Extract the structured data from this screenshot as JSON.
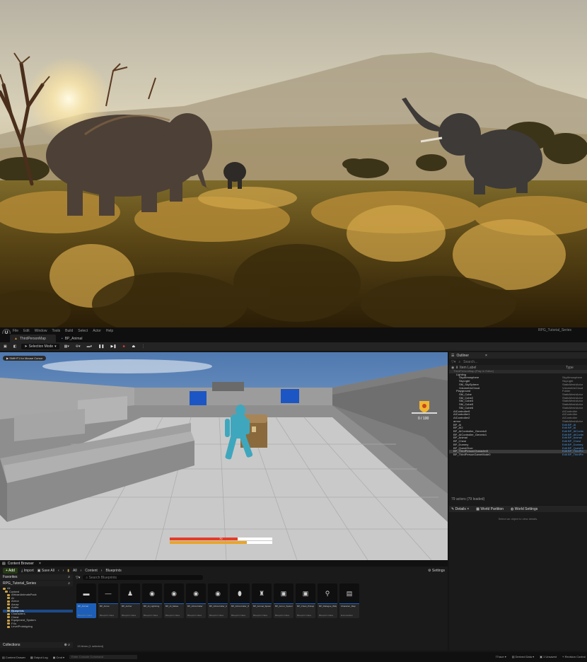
{
  "menu": {
    "items": [
      "File",
      "Edit",
      "Window",
      "Tools",
      "Build",
      "Select",
      "Actor",
      "Help"
    ],
    "project_name": "RPG_Tutorial_Series"
  },
  "tabs": [
    {
      "label": "ThirdPersonMap"
    },
    {
      "label": "BP_Animal"
    }
  ],
  "toolbar": {
    "selection_mode": "Selection Mode"
  },
  "viewport": {
    "hint": "Shift+F1 for Mouse Cursor",
    "hp_value": "70",
    "hp_fraction": 0.66,
    "stamina_fraction": 0.75,
    "gold_value": "0 / 100"
  },
  "outliner": {
    "title": "Outliner",
    "search_placeholder": "Search...",
    "col_label": "Item Label",
    "col_type": "Type",
    "rows": [
      {
        "label": "ThirdPersonMap (Play In Editor)",
        "type": ""
      },
      {
        "label": "Lighting",
        "type": ""
      },
      {
        "label": "SkyAtmosphere",
        "type": "SkyAtmosphere"
      },
      {
        "label": "SkyLight",
        "type": "SkyLight"
      },
      {
        "label": "SM_SkySphere",
        "type": "StaticMeshActor"
      },
      {
        "label": "VolumetricCloud",
        "type": "VolumetricCloud"
      },
      {
        "label": "Playground",
        "type": "Folder"
      },
      {
        "label": "SM_Cube",
        "type": "StaticMeshActor"
      },
      {
        "label": "SM_Cube2",
        "type": "StaticMeshActor"
      },
      {
        "label": "SM_Cube3",
        "type": "StaticMeshActor"
      },
      {
        "label": "SM_Cube5",
        "type": "StaticMeshActor"
      },
      {
        "label": "SM_Cube6",
        "type": "StaticMeshActor"
      },
      {
        "label": "AIController9",
        "type": "AIController"
      },
      {
        "label": "AIController1",
        "type": "AIController"
      },
      {
        "label": "AIController2",
        "type": "AIController"
      },
      {
        "label": "armor",
        "type": "StaticMeshActor"
      },
      {
        "label": "BP_AI",
        "type": "Edit BP_AI"
      },
      {
        "label": "BP_AI2",
        "type": "Edit BP_AI"
      },
      {
        "label": "BP_AIController_Generic0",
        "type": "Edit BP_AIController"
      },
      {
        "label": "BP_AIController_Generic1",
        "type": "Edit BP_AIController"
      },
      {
        "label": "BP_Animal",
        "type": "Edit BP_Animal"
      },
      {
        "label": "BP_Chest",
        "type": "Edit BP_Chest"
      },
      {
        "label": "BP_Dummy",
        "type": "Edit BP_Dummy"
      },
      {
        "label": "BP_QuestGiver",
        "type": "Edit BP_QuestGiver"
      },
      {
        "label": "BP_ThirdPersonCharacter0",
        "type": "Edit BP_ThirdPerson"
      },
      {
        "label": "BP_ThirdPersonGameMode0",
        "type": "Edit BP_ThirdPerson"
      }
    ],
    "footer": "79 actors (79 loaded)"
  },
  "details": {
    "tabs": [
      "Details",
      "World Partition",
      "World Settings"
    ],
    "empty": "Select an object to view details."
  },
  "content_browser": {
    "title": "Content Browser",
    "add": "Add",
    "import": "Import",
    "save_all": "Save All",
    "breadcrumb": [
      "All",
      "Content",
      "Blueprints"
    ],
    "settings": "Settings",
    "favorites": "Favorites",
    "project": "RPG_Tutorial_Series",
    "tree": [
      "All",
      "Content",
      "AfricanAnimalsPack",
      "AI",
      "Armor",
      "Arrow",
      "Audio",
      "Blueprints",
      "Characters",
      "Chest",
      "Equipment_System",
      "FXs",
      "LevelPrototyping"
    ],
    "collections": "Collections",
    "search_placeholder": "Search Blueprints",
    "assets": [
      {
        "name": "BP_Animal",
        "type": "Blueprint Class"
      },
      {
        "name": "BP_Arrow",
        "type": "Blueprint Class"
      },
      {
        "name": "BP_Archer",
        "type": "Blueprint Class"
      },
      {
        "name": "BP_AI_Lightning",
        "type": "Blueprint Class"
      },
      {
        "name": "BP_AI_Melee",
        "type": "Blueprint Class"
      },
      {
        "name": "BP_AIController",
        "type": "Blueprint Class"
      },
      {
        "name": "BP_AIController_Generic",
        "type": "Blueprint Class"
      },
      {
        "name": "BP_AIController_Wolf",
        "type": "Blueprint Class"
      },
      {
        "name": "BP_Animal_Spawner",
        "type": "Blueprint Class"
      },
      {
        "name": "BP_Armor_System",
        "type": "Blueprint Class"
      },
      {
        "name": "BP_Chest_Pickup",
        "type": "Blueprint Class"
      },
      {
        "name": "BP_Dialogue_Widget",
        "type": "Blueprint Class"
      },
      {
        "name": "Character_Map",
        "type": "Enumeration"
      }
    ],
    "item_count": "13 items (1 selected)"
  },
  "statusbar": {
    "items": [
      "Content Drawer",
      "Output Log",
      "Cmd"
    ],
    "cmd_placeholder": "Enter Console Command",
    "right": [
      "Trace",
      "Derived Data",
      "1 Unsaved",
      "Revision Control"
    ]
  }
}
